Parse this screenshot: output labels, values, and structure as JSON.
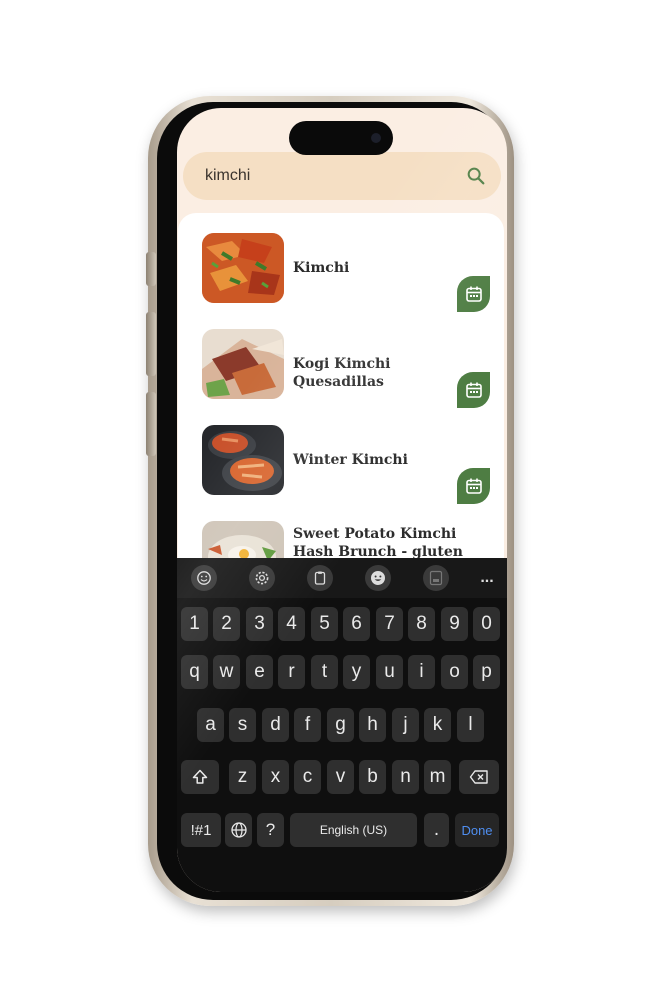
{
  "search": {
    "query": "kimchi"
  },
  "results": [
    {
      "title": "Kimchi"
    },
    {
      "title": "Kogi Kimchi Quesadillas"
    },
    {
      "title": "Winter Kimchi"
    },
    {
      "title": "Sweet Potato Kimchi Hash Brunch - gluten free, dairy"
    }
  ],
  "keyboard": {
    "toolbar_icons": [
      "emoji-icon",
      "settings-icon",
      "clipboard-icon",
      "sticker-icon",
      "keyboard-mode-icon",
      "more-icon"
    ],
    "more_label": "...",
    "number_row": [
      "1",
      "2",
      "3",
      "4",
      "5",
      "6",
      "7",
      "8",
      "9",
      "0"
    ],
    "row1": [
      "q",
      "w",
      "e",
      "r",
      "t",
      "y",
      "u",
      "i",
      "o",
      "p"
    ],
    "row2": [
      "a",
      "s",
      "d",
      "f",
      "g",
      "h",
      "j",
      "k",
      "l"
    ],
    "row3": [
      "z",
      "x",
      "c",
      "v",
      "b",
      "n",
      "m"
    ],
    "symbols_label": "!#1",
    "question_label": "?",
    "space_label": "English (US)",
    "period_label": ".",
    "done_label": "Done"
  },
  "colors": {
    "accent_green": "#4e7d43",
    "search_bg": "#f5dfc4",
    "done_blue": "#4f8ef0"
  }
}
